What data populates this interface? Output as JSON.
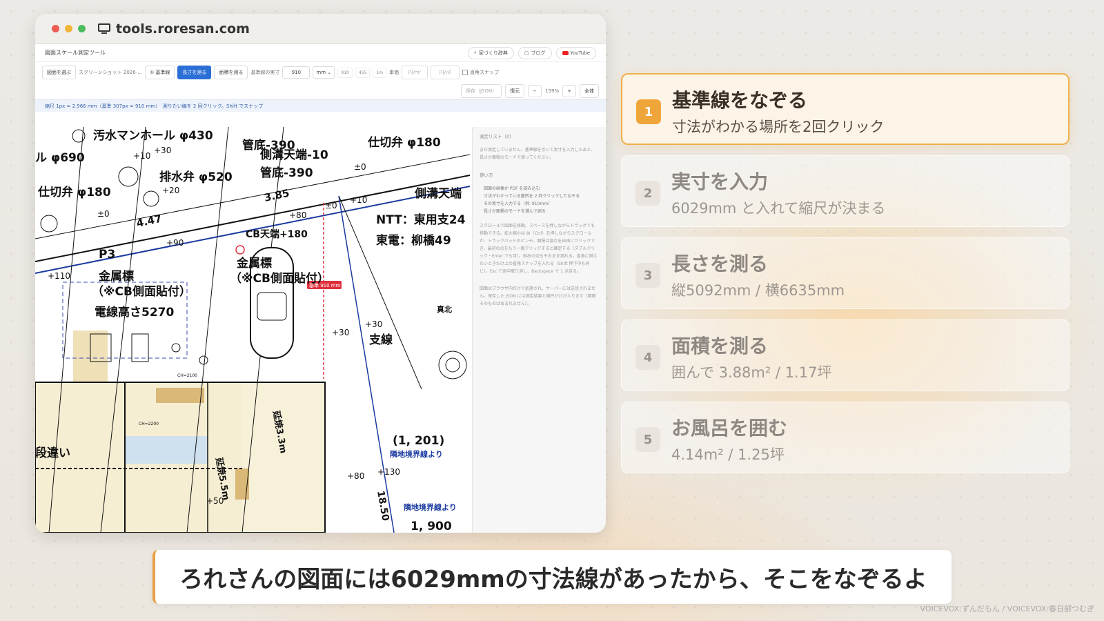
{
  "browser": {
    "url": "tools.roresan.com"
  },
  "app": {
    "title": "図面スケール測定ツール",
    "header_links": [
      "家づくり辞典",
      "ブログ",
      "YouTube"
    ],
    "toolbar": {
      "choose_drawing": "図面を選ぶ",
      "file_name": "スクリーンショット 2026-...",
      "baseline_mode": "① 基準線",
      "length_mode": "長さを測る",
      "area_mode": "面積を測る",
      "actual_label": "基準線の実寸",
      "actual_value": "910",
      "unit_value": "mm",
      "presets": [
        "910",
        "455",
        "1m"
      ],
      "price_label": "単価",
      "price_placeholder": "円/m²",
      "price_placeholder2": "円/㎡",
      "snap_label": "直角スナップ"
    },
    "toolbar2": {
      "save": "保存（JSON）",
      "restore": "復元",
      "zoom_out": "−",
      "zoom_level": "159%",
      "zoom_in": "+",
      "fit": "全体"
    },
    "scale_info": "縮尺 1px = 2.966 mm（基準 307px = 910 mm）　測りたい線を 2 回クリック。Shift でスナップ",
    "side_panel": {
      "title": "測定リスト（0）",
      "empty": "まだ測定していません。基準線を引いて実寸を入力したあと、長さか面積のモードで測ってください。",
      "howto_title": "使い方",
      "howto_items": [
        "図面の画像か PDF を読み込む",
        "寸法がわかっている箇所を 2 回クリックしてなぞる",
        "その実寸を入力する（例: 910mm）",
        "長さか面積のモードを選んで測る"
      ],
      "notes": "スクロールで図面を移動。スペースを押しながらドラッグでも移動できる。拡大縮小は ⌘（Ctrl）を押しながらスクロールか、トラックパッドのピンチ。面積は頂点を自由にクリックでき、最初の点をもう一度クリックすると確定する（ダブルクリック・Enter でも可）。斜めの辺もそのまま測れる。直角に揃えたいときだけ上の直角スナップを入れる（Shift 押下中も同じ）。Esc で途中取り消し、Backspace で 1 点戻る。",
      "privacy": "図面はブラウザ内だけで処理され、サーバーには送信されません。保存した JSON には測定結果と縮尺だけが入ります（図面そのものは含まれません）。"
    },
    "drawing_labels": {
      "baseline_tag": "基準 910 mm",
      "l1": "汚水マンホール φ430",
      "l2": "ル φ690",
      "l3": "排水弁 φ520",
      "l4": "仕切弁 φ180",
      "l5": "仕切弁 φ180",
      "l6": "管底-390",
      "l7": "側溝天端-10",
      "l8": "管底-390",
      "l9": "側溝天端",
      "l10": "NTT：東用支24",
      "l11": "東電：柳橋49",
      "l12": "CB天端+180",
      "l13": "金属標",
      "l14": "（※CB側面貼付）",
      "l15": "金属標",
      "l16": "（※CB側面貼付）",
      "l17": "電線高さ5270",
      "l18": "支線",
      "l19": "真北",
      "l20": "(1, 201)",
      "l21": "隣地境界線より",
      "l22": "隣地境界線より",
      "l23": "1, 900",
      "l24": "段違い",
      "l25": "延焼5.5m",
      "l26": "延焼3.3m",
      "l27": "18.50",
      "l28": "3.85",
      "l29": "4.47",
      "l30": "P3",
      "p1": "+10",
      "p2": "+30",
      "p3": "+20",
      "p4": "±0",
      "p5": "±0",
      "p6": "+10",
      "p7": "+80",
      "p8": "+90",
      "p9": "+110",
      "p10": "+30",
      "p11": "+30",
      "p12": "+80",
      "p13": "+130",
      "p14": "+50",
      "p15": "±0",
      "ch1": "CH=2100",
      "ch2": "CH=2200"
    }
  },
  "steps": [
    {
      "num": "1",
      "title": "基準線をなぞる",
      "desc": "寸法がわかる場所を2回クリック"
    },
    {
      "num": "2",
      "title": "実寸を入力",
      "desc": "6029mm と入れて縮尺が決まる"
    },
    {
      "num": "3",
      "title": "長さを測る",
      "desc": "縦5092mm / 横6635mm"
    },
    {
      "num": "4",
      "title": "面積を測る",
      "desc": "囲んで 3.88m² / 1.17坪"
    },
    {
      "num": "5",
      "title": "お風呂を囲む",
      "desc": "4.14m² / 1.25坪"
    }
  ],
  "subtitle": "ろれさんの図面には6029mmの寸法線があったから、そこをなぞるよ",
  "credit": "VOICEVOX:ずんだもん / VOICEVOX:春日部つむぎ",
  "colors": {
    "accent": "#f0a53a",
    "active_border": "#f0b04a",
    "app_blue": "#2b6fd6",
    "baseline_red": "#e0313c"
  }
}
